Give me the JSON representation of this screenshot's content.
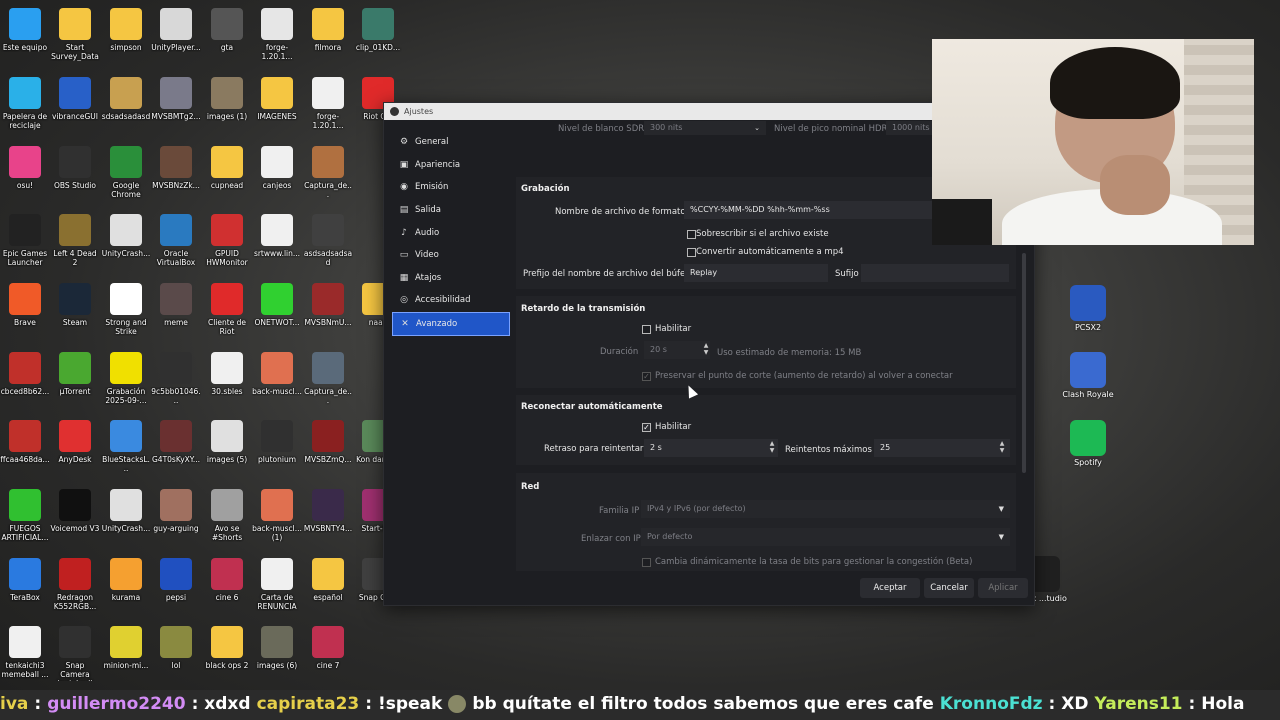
{
  "desktop": {
    "icons": [
      {
        "label": "Este equipo",
        "icon": "monitor-icon",
        "color": "#2a9ff0"
      },
      {
        "label": "Start Survey_Data",
        "icon": "folder-icon",
        "color": "#f5c642"
      },
      {
        "label": "simpson",
        "icon": "folder-icon",
        "color": "#f5c642"
      },
      {
        "label": "UnityPlayer...",
        "icon": "file-gear-icon",
        "color": "#d8d8d8"
      },
      {
        "label": "gta",
        "icon": "file-icon",
        "color": "#555555"
      },
      {
        "label": "forge-1.20.1...",
        "icon": "java-icon",
        "color": "#e6e6e6"
      },
      {
        "label": "filmora",
        "icon": "folder-icon",
        "color": "#f5c642"
      },
      {
        "label": "clip_01KD...",
        "icon": "video-icon",
        "color": "#3a7a6a"
      },
      {
        "label": "Papelera de reciclaje",
        "icon": "recycle-bin-icon",
        "color": "#2ab0e8"
      },
      {
        "label": "vibranceGUI",
        "icon": "gear-icon",
        "color": "#2860c8"
      },
      {
        "label": "sdsadsadasd",
        "icon": "image-icon",
        "color": "#c8a050"
      },
      {
        "label": "MVSBMTg2...",
        "icon": "image-icon",
        "color": "#7a7a8a"
      },
      {
        "label": "images (1)",
        "icon": "image-icon",
        "color": "#8a7a60"
      },
      {
        "label": "IMAGENES",
        "icon": "folder-icon",
        "color": "#f5c642"
      },
      {
        "label": "forge-1.20.1...",
        "icon": "file-icon",
        "color": "#f0f0f0"
      },
      {
        "label": "Riot C...",
        "icon": "riot-icon",
        "color": "#e02a2a"
      },
      {
        "label": "osu!",
        "icon": "osu-icon",
        "color": "#e8438a"
      },
      {
        "label": "OBS Studio",
        "icon": "obs-icon",
        "color": "#303030"
      },
      {
        "label": "Google Chrome",
        "icon": "chrome-icon",
        "color": "#2a8f3a"
      },
      {
        "label": "MVSBNzZk...",
        "icon": "image-icon",
        "color": "#6a4a3a"
      },
      {
        "label": "cupnead",
        "icon": "folder-icon",
        "color": "#f5c642"
      },
      {
        "label": "canjeos",
        "icon": "file-icon",
        "color": "#f0f0f0"
      },
      {
        "label": "Captura_de...",
        "icon": "image-icon",
        "color": "#b07040"
      },
      {
        "label": "Epic Games Launcher",
        "icon": "epic-icon",
        "color": "#222222"
      },
      {
        "label": "Left 4 Dead 2",
        "icon": "l4d2-icon",
        "color": "#8a7030"
      },
      {
        "label": "UnityCrash...",
        "icon": "unity-icon",
        "color": "#e0e0e0"
      },
      {
        "label": "Oracle VirtualBox",
        "icon": "virtualbox-icon",
        "color": "#2a7ac0"
      },
      {
        "label": "GPUID HWMonitor",
        "icon": "hwmonitor-icon",
        "color": "#d03030"
      },
      {
        "label": "srtwww.lin...",
        "icon": "file-icon",
        "color": "#f0f0f0"
      },
      {
        "label": "asdsadsadsad",
        "icon": "image-icon",
        "color": "#404040"
      },
      {
        "label": "Brave",
        "icon": "brave-icon",
        "color": "#f05a28"
      },
      {
        "label": "Steam",
        "icon": "steam-icon",
        "color": "#1b2838"
      },
      {
        "label": "Strong and Strike",
        "icon": "video-icon",
        "color": "#ffffff"
      },
      {
        "label": "meme",
        "icon": "video-icon",
        "color": "#5a4a4a"
      },
      {
        "label": "Cliente de Riot",
        "icon": "riot-icon",
        "color": "#e02a2a"
      },
      {
        "label": "ONETWOT...",
        "icon": "image-icon",
        "color": "#30d030"
      },
      {
        "label": "MVSBNmU...",
        "icon": "image-icon",
        "color": "#9a2a2a"
      },
      {
        "label": "naaa",
        "icon": "folder-icon",
        "color": "#f5c642"
      },
      {
        "label": "cbced8b62...",
        "icon": "image-icon",
        "color": "#c0302a"
      },
      {
        "label": "µTorrent",
        "icon": "utorrent-icon",
        "color": "#4aa830"
      },
      {
        "label": "Grabación 2025-09-...",
        "icon": "video-icon",
        "color": "#f0e000"
      },
      {
        "label": "9c5bb01046...",
        "icon": "image-icon",
        "color": "#303030"
      },
      {
        "label": "30.sbles",
        "icon": "file-icon",
        "color": "#f0f0f0"
      },
      {
        "label": "back-muscl...",
        "icon": "image-icon",
        "color": "#e07050"
      },
      {
        "label": "Captura_de...",
        "icon": "image-icon",
        "color": "#5a6a7a"
      },
      {
        "label": "ffcaa468da...",
        "icon": "image-icon",
        "color": "#c0302a"
      },
      {
        "label": "AnyDesk",
        "icon": "anydesk-icon",
        "color": "#e03030"
      },
      {
        "label": "BlueStacksL...",
        "icon": "bluestacks-icon",
        "color": "#3a8ae0"
      },
      {
        "label": "G4T0sKyXY...",
        "icon": "image-icon",
        "color": "#6a3030"
      },
      {
        "label": "images (5)",
        "icon": "image-icon",
        "color": "#e0e0e0"
      },
      {
        "label": "plutonium",
        "icon": "plutonium-icon",
        "color": "#303030"
      },
      {
        "label": "MVSBZmQ...",
        "icon": "image-icon",
        "color": "#8a2020"
      },
      {
        "label": "Kon danci...",
        "icon": "video-icon",
        "color": "#5a8a5a"
      },
      {
        "label": "FUEGOS ARTIFICIAL...",
        "icon": "video-icon",
        "color": "#30c030"
      },
      {
        "label": "Voicemod V3",
        "icon": "voicemod-icon",
        "color": "#101010"
      },
      {
        "label": "UnityCrash...",
        "icon": "unity-icon",
        "color": "#e0e0e0"
      },
      {
        "label": "guy-arguing",
        "icon": "image-icon",
        "color": "#a07060"
      },
      {
        "label": "Avo se #Shorts",
        "icon": "image-icon",
        "color": "#a0a0a0"
      },
      {
        "label": "back-muscl... (1)",
        "icon": "image-icon",
        "color": "#e07050"
      },
      {
        "label": "MVSBNTY4...",
        "icon": "image-icon",
        "color": "#3a2a4a"
      },
      {
        "label": "Start-S...",
        "icon": "winrar-icon",
        "color": "#a03070"
      },
      {
        "label": "TeraBox",
        "icon": "terabox-icon",
        "color": "#2a7ae0"
      },
      {
        "label": "Redragon K552RGB...",
        "icon": "redragon-icon",
        "color": "#c02020"
      },
      {
        "label": "kurama",
        "icon": "folder-icon",
        "color": "#f5a030"
      },
      {
        "label": "pepsi",
        "icon": "image-icon",
        "color": "#2050c0"
      },
      {
        "label": "cine 6",
        "icon": "image-icon",
        "color": "#c03050"
      },
      {
        "label": "Carta de RENUNCIA",
        "icon": "document-icon",
        "color": "#f0f0f0"
      },
      {
        "label": "español",
        "icon": "folder-icon",
        "color": "#f5c642"
      },
      {
        "label": "Snap Ca...",
        "icon": "snapcamera-icon",
        "color": "#404040"
      },
      {
        "label": "tenkaichi3 memeball ...",
        "icon": "file-icon",
        "color": "#f0f0f0"
      },
      {
        "label": "Snap Camera (patched)",
        "icon": "snapcamera-icon",
        "color": "#303030"
      },
      {
        "label": "minion-mi...",
        "icon": "image-icon",
        "color": "#e0d030"
      },
      {
        "label": "lol",
        "icon": "image-icon",
        "color": "#8a8a40"
      },
      {
        "label": "black ops 2",
        "icon": "folder-icon",
        "color": "#f5c642"
      },
      {
        "label": "images (6)",
        "icon": "image-icon",
        "color": "#6a6a5a"
      },
      {
        "label": "cine 7",
        "icon": "image-icon",
        "color": "#c03050"
      }
    ],
    "right_icons": [
      {
        "label": "PCSX2",
        "icon": "pcsx2-icon",
        "color": "#2a5ac0"
      },
      {
        "label": "Clash Royale",
        "icon": "clash-royale-icon",
        "color": "#3a6ad0"
      },
      {
        "label": "Spotify",
        "icon": "spotify-icon",
        "color": "#1db954"
      },
      {
        "label": "...lox ...tudio",
        "icon": "roblox-studio-icon",
        "color": "#202020"
      }
    ]
  },
  "dialog": {
    "title": "Ajustes",
    "nav": [
      {
        "label": "General",
        "icon": "gear-icon",
        "glyph": "⚙"
      },
      {
        "label": "Apariencia",
        "icon": "palette-icon",
        "glyph": "▣"
      },
      {
        "label": "Emisión",
        "icon": "broadcast-icon",
        "glyph": "◉"
      },
      {
        "label": "Salida",
        "icon": "output-icon",
        "glyph": "▤"
      },
      {
        "label": "Audio",
        "icon": "speaker-icon",
        "glyph": "♪"
      },
      {
        "label": "Video",
        "icon": "video-icon",
        "glyph": "▭"
      },
      {
        "label": "Atajos",
        "icon": "keyboard-icon",
        "glyph": "▦"
      },
      {
        "label": "Accesibilidad",
        "icon": "accessibility-icon",
        "glyph": "◎"
      },
      {
        "label": "Avanzado",
        "icon": "tools-icon",
        "glyph": "✕"
      }
    ],
    "top_partial": {
      "sdr_label": "Nivel de blanco SDR",
      "sdr_value": "300 nits",
      "hdr_label": "Nivel de pico nominal HDR",
      "hdr_value": "1000 nits"
    },
    "recording": {
      "header": "Grabación",
      "format_label": "Nombre de archivo de formato",
      "format_value": "%CCYY-%MM-%DD %hh-%mm-%ss",
      "overwrite_label": "Sobrescribir si el archivo existe",
      "remux_label": "Convertir automáticamente a mp4",
      "buffer_prefix_label": "Prefijo del nombre de archivo del búfer",
      "buffer_prefix_value": "Replay",
      "suffix_label": "Sufijo",
      "suffix_value": ""
    },
    "delay": {
      "header": "Retardo de la transmisión",
      "enable_label": "Habilitar",
      "duration_label": "Duración",
      "duration_value": "20 s",
      "memory_text": "Uso estimado de memoria: 15 MB",
      "preserve_label": "Preservar el punto de corte (aumento de retardo) al volver a conectar"
    },
    "reconnect": {
      "header": "Reconectar automáticamente",
      "enable_label": "Habilitar",
      "retry_label": "Retraso para reintentar",
      "retry_value": "2 s",
      "max_label": "Reintentos máximos",
      "max_value": "25"
    },
    "network": {
      "header": "Red",
      "family_label": "Familia IP",
      "family_value": "IPv4 y IPv6 (por defecto)",
      "bind_label": "Enlazar con IP",
      "bind_value": "Por defecto",
      "dynamic_label": "Cambia dinámicamente la tasa de bits para gestionar la congestión (Beta)"
    },
    "buttons": {
      "ok": "Aceptar",
      "cancel": "Cancelar",
      "apply": "Aplicar"
    }
  },
  "chat": [
    {
      "user": "iva",
      "msg": ":"
    },
    {
      "user": "guillermo2240",
      "msg": ": xdxd"
    },
    {
      "user": "capirata23",
      "msg": ": !speak"
    },
    {
      "user": "",
      "msg": "bb quítate el filtro todos sabemos que eres cafe"
    },
    {
      "user": "KronnoFdz",
      "msg": ": XD"
    },
    {
      "user": "Yarens11",
      "msg": ": Hola"
    }
  ],
  "colors": {
    "accent": "#2056c8",
    "dialog_bg": "#1d1e22",
    "field_bg": "#2b2c31"
  }
}
